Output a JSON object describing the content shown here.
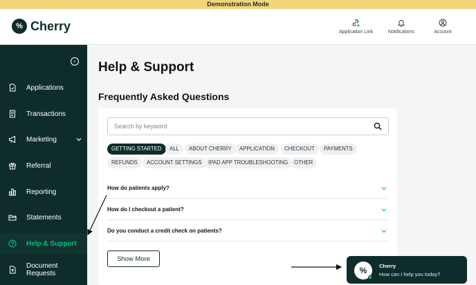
{
  "banner": {
    "text": "Demonstration Mode"
  },
  "brand": {
    "logo_glyph": "%",
    "name": "Cherry"
  },
  "top_actions": [
    {
      "label": "Application Link",
      "icon": "link-icon"
    },
    {
      "label": "Notifications",
      "icon": "bell-icon"
    },
    {
      "label": "Account",
      "icon": "user-circle-icon"
    }
  ],
  "sidebar": {
    "items": [
      {
        "label": "Applications",
        "icon": "document-check-icon"
      },
      {
        "label": "Transactions",
        "icon": "receipt-icon"
      },
      {
        "label": "Marketing",
        "icon": "megaphone-icon"
      },
      {
        "label": "Referral",
        "icon": "gift-icon"
      },
      {
        "label": "Reporting",
        "icon": "bar-chart-icon"
      },
      {
        "label": "Statements",
        "icon": "folder-icon"
      },
      {
        "label": "Help & Support",
        "icon": "help-circle-icon",
        "active": true
      },
      {
        "label": "Document Requests",
        "icon": "document-upload-icon"
      }
    ]
  },
  "page": {
    "title": "Help & Support",
    "faq_heading": "Frequently Asked Questions"
  },
  "search": {
    "placeholder": "Search by keyword",
    "value": ""
  },
  "categories": [
    "GETTING STARTED",
    "ALL",
    "ABOUT CHERRY",
    "APPLICATION",
    "CHECKOUT",
    "PAYMENTS",
    "REFUNDS",
    "ACCOUNT SETTINGS",
    "IPAD APP TROUBLESHOOTING",
    "OTHER"
  ],
  "selected_category": "GETTING STARTED",
  "faqs": [
    "How do patients apply?",
    "How do I checkout a patient?",
    "Do you conduct a credit check on patients?"
  ],
  "show_more_label": "Show More",
  "chat": {
    "avatar_glyph": "%",
    "name": "Cherry",
    "message": "How can I help you today?"
  },
  "colors": {
    "brand_dark": "#0e2c2c",
    "accent_green": "#00c37d",
    "banner_yellow": "#efd77a"
  }
}
